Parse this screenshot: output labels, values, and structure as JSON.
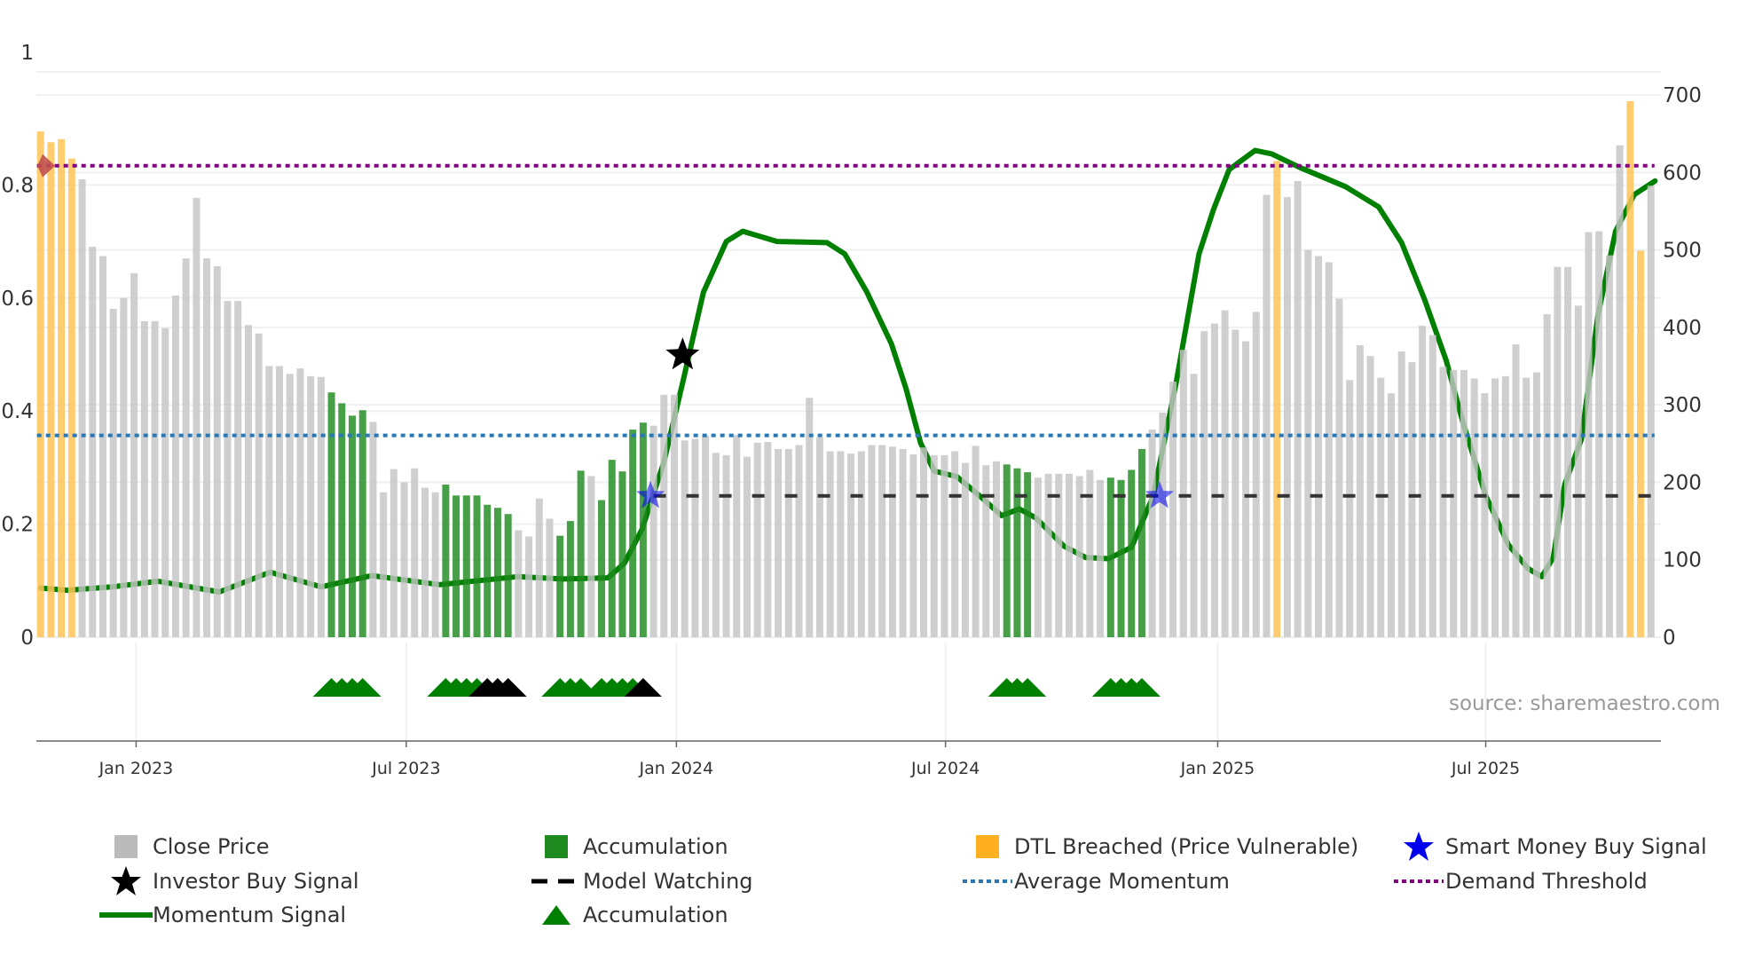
{
  "chart_data": {
    "type": "bar",
    "x_unit": "week index",
    "left_axis": {
      "ylim": [
        0,
        1
      ],
      "ticks": [
        "0",
        "0.2",
        "0.4",
        "0.6",
        "0.8",
        "1"
      ],
      "tick_values": [
        0,
        0.2,
        0.4,
        0.6,
        0.8,
        1
      ]
    },
    "right_axis": {
      "ylim": [
        0,
        700
      ],
      "ticks": [
        "0",
        "100",
        "200",
        "300",
        "400",
        "500",
        "600",
        "700"
      ],
      "tick_values": [
        0,
        100,
        200,
        300,
        400,
        500,
        600,
        700
      ]
    },
    "x_ticks": [
      {
        "label": "Jan 2023",
        "week": 9.2
      },
      {
        "label": "Jul 2023",
        "week": 35.2
      },
      {
        "label": "Jan 2024",
        "week": 61.2
      },
      {
        "label": "Jul 2024",
        "week": 87.1
      },
      {
        "label": "Jan 2025",
        "week": 113.3
      },
      {
        "label": "Jul 2025",
        "week": 139.1
      }
    ],
    "close_price": [
      653,
      639,
      643,
      618,
      591,
      504,
      492,
      424,
      438,
      470,
      408,
      408,
      399,
      441,
      489,
      567,
      489,
      479,
      434,
      434,
      403,
      392,
      350,
      350,
      340,
      347,
      337,
      336,
      316,
      302,
      286,
      293,
      278,
      187,
      217,
      200,
      218,
      193,
      187,
      197,
      183,
      183,
      183,
      171,
      167,
      159,
      138,
      130,
      179,
      153,
      131,
      150,
      215,
      208,
      177,
      229,
      214,
      268,
      277,
      273,
      313,
      313,
      254,
      256,
      260,
      238,
      235,
      261,
      233,
      251,
      252,
      243,
      243,
      248,
      309,
      258,
      240,
      240,
      237,
      240,
      248,
      248,
      246,
      243,
      236,
      245,
      235,
      235,
      240,
      225,
      247,
      222,
      227,
      223,
      218,
      213,
      206,
      211,
      211,
      211,
      208,
      216,
      203,
      206,
      203,
      216,
      243,
      268,
      290,
      330,
      371,
      340,
      395,
      405,
      422,
      397,
      382,
      420,
      571,
      615,
      568,
      589,
      500,
      492,
      484,
      437,
      332,
      377,
      363,
      335,
      315,
      369,
      355,
      402,
      390,
      349,
      345,
      345,
      334,
      315,
      334,
      337,
      378,
      335,
      342,
      417,
      478,
      478,
      428,
      523,
      524,
      493,
      635,
      692,
      499,
      583
    ],
    "bar_type": "DDDDCCCCCCCCCCCCCCCCCCCCCCCCAAAACCCCCCCAAAAAAACCCCAAACAAAAACCCCCCCCCCCCCCCCCCCCCCCCCCCCCCCCCCAAACCCCCCCAAAACCCCCCCCCCCCDCCCCCCCCCCCCCCCCCCCCCCCCCCCCCCCCCDDCC",
    "bar_type_legend": {
      "C": "Close Price",
      "A": "Accumulation",
      "D": "DTL Breached (Price Vulnerable)"
    },
    "momentum_signal": [
      [
        0,
        0.087
      ],
      [
        2.6,
        0.083
      ],
      [
        6.9,
        0.089
      ],
      [
        11.3,
        0.099
      ],
      [
        17.2,
        0.08
      ],
      [
        22.1,
        0.115
      ],
      [
        27,
        0.089
      ],
      [
        31.9,
        0.109
      ],
      [
        38.4,
        0.093
      ],
      [
        45.9,
        0.107
      ],
      [
        50.3,
        0.103
      ],
      [
        54.6,
        0.105
      ],
      [
        56.2,
        0.131
      ],
      [
        57.9,
        0.191
      ],
      [
        60,
        0.31
      ],
      [
        61.8,
        0.45
      ],
      [
        63.8,
        0.61
      ],
      [
        66,
        0.7
      ],
      [
        67.6,
        0.718
      ],
      [
        70.9,
        0.7
      ],
      [
        75.7,
        0.698
      ],
      [
        77.4,
        0.678
      ],
      [
        79.5,
        0.612
      ],
      [
        81.9,
        0.519
      ],
      [
        83.3,
        0.44
      ],
      [
        84.7,
        0.344
      ],
      [
        86,
        0.294
      ],
      [
        88.2,
        0.284
      ],
      [
        90.4,
        0.25
      ],
      [
        92.5,
        0.215
      ],
      [
        94.2,
        0.227
      ],
      [
        95.8,
        0.211
      ],
      [
        98.5,
        0.161
      ],
      [
        100.6,
        0.141
      ],
      [
        102.8,
        0.139
      ],
      [
        105,
        0.159
      ],
      [
        107.1,
        0.25
      ],
      [
        109.3,
        0.45
      ],
      [
        111.5,
        0.678
      ],
      [
        112.9,
        0.757
      ],
      [
        114.4,
        0.827
      ],
      [
        116.9,
        0.861
      ],
      [
        118.5,
        0.855
      ],
      [
        121.2,
        0.831
      ],
      [
        125.6,
        0.797
      ],
      [
        128.8,
        0.761
      ],
      [
        131,
        0.698
      ],
      [
        133.2,
        0.598
      ],
      [
        135.3,
        0.489
      ],
      [
        136.9,
        0.38
      ],
      [
        139.1,
        0.25
      ],
      [
        141.3,
        0.163
      ],
      [
        143.2,
        0.121
      ],
      [
        144.5,
        0.107
      ],
      [
        145.6,
        0.141
      ],
      [
        146.7,
        0.27
      ],
      [
        148.3,
        0.35
      ],
      [
        149.9,
        0.569
      ],
      [
        151.6,
        0.718
      ],
      [
        153.4,
        0.783
      ],
      [
        155.4,
        0.807
      ]
    ],
    "demand_threshold": 0.834,
    "average_momentum": 0.357,
    "model_watching": {
      "value": 0.25,
      "from_week": 59,
      "to_week": 155
    },
    "investor_buy_signals": [
      [
        61.8,
        0.499
      ]
    ],
    "smart_money_buy_signals": [
      [
        58.7,
        0.25
      ],
      [
        107.7,
        0.25
      ]
    ],
    "threshold_marker": [
      0.2,
      0.834
    ],
    "accumulation_triangles": [
      {
        "week": 28,
        "color": "green"
      },
      {
        "week": 29,
        "color": "green"
      },
      {
        "week": 30,
        "color": "green"
      },
      {
        "week": 31,
        "color": "green"
      },
      {
        "week": 39,
        "color": "green"
      },
      {
        "week": 40,
        "color": "green"
      },
      {
        "week": 41,
        "color": "green"
      },
      {
        "week": 42,
        "color": "green"
      },
      {
        "week": 43,
        "color": "black"
      },
      {
        "week": 44,
        "color": "black"
      },
      {
        "week": 45,
        "color": "black"
      },
      {
        "week": 50,
        "color": "green"
      },
      {
        "week": 51,
        "color": "green"
      },
      {
        "week": 52,
        "color": "green"
      },
      {
        "week": 54,
        "color": "green"
      },
      {
        "week": 55,
        "color": "green"
      },
      {
        "week": 56,
        "color": "green"
      },
      {
        "week": 57,
        "color": "green"
      },
      {
        "week": 58,
        "color": "black"
      },
      {
        "week": 93,
        "color": "green"
      },
      {
        "week": 94,
        "color": "green"
      },
      {
        "week": 95,
        "color": "green"
      },
      {
        "week": 103,
        "color": "green"
      },
      {
        "week": 104,
        "color": "green"
      },
      {
        "week": 105,
        "color": "green"
      },
      {
        "week": 106,
        "color": "green"
      }
    ],
    "legend_placement": "bottom",
    "grid": true
  },
  "colors": {
    "close": "#c4c4c4",
    "accumulation": "#1f8a1f",
    "dtl": "#ffc457",
    "dtl_legend": "#ffb020",
    "momentum": "#008000",
    "average": "#2a77b4",
    "threshold": "#800080",
    "smart_money": "#0000ee",
    "investor": "#000000",
    "watching": "#333333",
    "marker": "#c0504d"
  },
  "legend": [
    {
      "label": "Close Price",
      "icon": "gray-square"
    },
    {
      "label": "Investor Buy Signal",
      "icon": "black-star"
    },
    {
      "label": "Momentum Signal",
      "icon": "green-line"
    },
    {
      "label": "Accumulation",
      "icon": "green-square"
    },
    {
      "label": "Model Watching",
      "icon": "black-dashed-line"
    },
    {
      "label": "Accumulation",
      "icon": "green-triangle"
    },
    {
      "label": "DTL Breached (Price Vulnerable)",
      "icon": "orange-square"
    },
    {
      "label": "Average Momentum",
      "icon": "blue-dotted-line"
    },
    {
      "label": "Smart Money Buy Signal",
      "icon": "blue-star"
    },
    {
      "label": "Demand Threshold",
      "icon": "purple-dotted-line"
    }
  ],
  "source": "source: sharemaestro.com"
}
